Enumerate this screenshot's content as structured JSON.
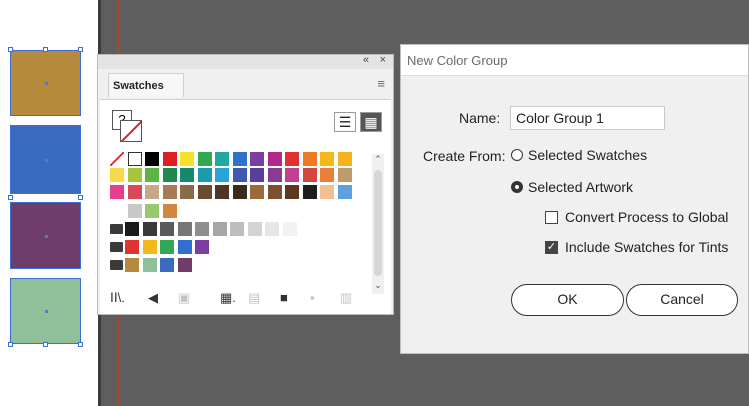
{
  "artwork": {
    "colors": [
      "#b58a3c",
      "#3a6bbf",
      "#6e3d6c",
      "#8fc09a"
    ]
  },
  "swatches_panel": {
    "collapse_label": "«",
    "close_label": "×",
    "tab_label": "Swatches",
    "menu_icon": "≡",
    "list_view_icon": "list-view-icon",
    "grid_view_icon": "grid-view-icon",
    "rows": [
      [
        "#ffffff",
        "#ffffff",
        "#000000",
        "#e02020",
        "#f5e12a",
        "#33a852",
        "#21a9a0",
        "#2f6fce",
        "#7a3fa0",
        "#b3288a",
        "#e0322f",
        "#f07a23",
        "#f5b81c",
        "#f5b21d"
      ],
      [
        "#f7d94a",
        "#a6c43c",
        "#5ab545",
        "#1f8a4c",
        "#138a6e",
        "#1b9bb0",
        "#2aa3d8",
        "#3e5bb0",
        "#5a3e9e",
        "#8a3b95",
        "#c2408f",
        "#d2483d",
        "#e87e3a",
        "#c09a6a"
      ],
      [
        "#e83e8c",
        "#d84a5a",
        "#c8a88a",
        "#a87a56",
        "#8a6a48",
        "#6b4a32",
        "#4d3626",
        "#3a2a1e",
        "#9a6a3a",
        "#7a5030",
        "#5a3820",
        "#1e1e1e",
        "#f0c090",
        "#5fa0e0"
      ],
      [
        "#ffffff",
        "#c8c8c8",
        "#9ac870",
        "#d08840"
      ],
      [
        "#1a1a1a",
        "#3a3a3a",
        "#5a5a5a",
        "#777777",
        "#8e8e8e",
        "#a6a6a6",
        "#bebebe",
        "#d4d4d4",
        "#e6e6e6",
        "#f2f2f2"
      ],
      [
        "#e0322f",
        "#f5b81c",
        "#33a852",
        "#2f6fce",
        "#7a3fa0"
      ],
      [
        "#b58a3c",
        "#8fc09a",
        "#3a6bbf",
        "#6e3d6c"
      ]
    ],
    "footer_icons": [
      "library-icon",
      "swatch-kind-icon",
      "swatch-options-icon",
      "color-group-icon",
      "edit-group-icon",
      "new-group-icon",
      "new-swatch-icon",
      "delete-icon"
    ]
  },
  "dialog": {
    "title": "New Color Group",
    "name_label": "Name:",
    "name_value": "Color Group 1",
    "create_from_label": "Create From:",
    "option_selected_swatches": "Selected Swatches",
    "option_selected_artwork": "Selected Artwork",
    "selected_option": "Selected Artwork",
    "convert_process_label": "Convert Process to Global",
    "convert_process_checked": false,
    "include_tints_label": "Include Swatches for Tints",
    "include_tints_checked": true,
    "ok_label": "OK",
    "cancel_label": "Cancel"
  }
}
